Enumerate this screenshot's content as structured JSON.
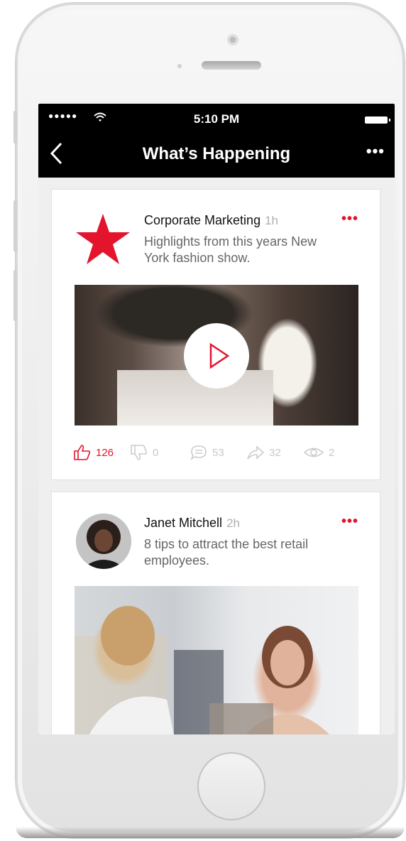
{
  "status_bar": {
    "signal": "●●●●●",
    "time": "5:10 PM"
  },
  "nav": {
    "title": "What’s Happening",
    "more": "•••"
  },
  "posts": [
    {
      "author": "Corporate Marketing",
      "time": "1h",
      "text": "Highlights from this years New York fashion show.",
      "more": "•••",
      "actions": {
        "likes": "126",
        "dislikes": "0",
        "comments": "53",
        "shares": "32",
        "views": "2"
      }
    },
    {
      "author": "Janet Mitchell",
      "time": "2h",
      "text": "8 tips to attract the best retail employees.",
      "more": "•••"
    }
  ],
  "colors": {
    "accent": "#e4142c",
    "nav_background": "#000000",
    "feed_background": "#efefef"
  },
  "icons": [
    "wifi-icon",
    "battery-icon",
    "back-chevron-icon",
    "star-logo-icon",
    "play-icon",
    "like-icon",
    "dislike-icon",
    "comment-icon",
    "share-icon",
    "views-icon"
  ]
}
